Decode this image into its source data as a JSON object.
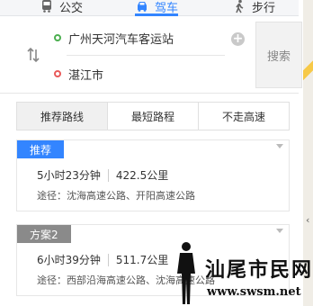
{
  "modes": [
    {
      "label": "公交",
      "icon": "bus-icon"
    },
    {
      "label": "驾车",
      "icon": "car-icon",
      "active": true
    },
    {
      "label": "步行",
      "icon": "walk-icon"
    }
  ],
  "search": {
    "start": "广州天河汽车客运站",
    "end": "湛江市",
    "button": "搜索"
  },
  "route_tabs": [
    "推荐路线",
    "最短路程",
    "不走高速"
  ],
  "routes": [
    {
      "tag": "推荐",
      "duration": "5小时23分钟",
      "distance": "422.5公里",
      "via": "途径：沈海高速公路、开阳高速公路"
    },
    {
      "tag": "方案2",
      "duration": "6小时39分钟",
      "distance": "511.7公里",
      "via": "途径：西部沿海高速公路、沈海高速公路"
    }
  ],
  "watermark": {
    "brand": "汕尾市民网",
    "url": "www.swsm.net"
  },
  "colors": {
    "accent": "#3385ff",
    "tag_gray": "#8a8a8a"
  }
}
